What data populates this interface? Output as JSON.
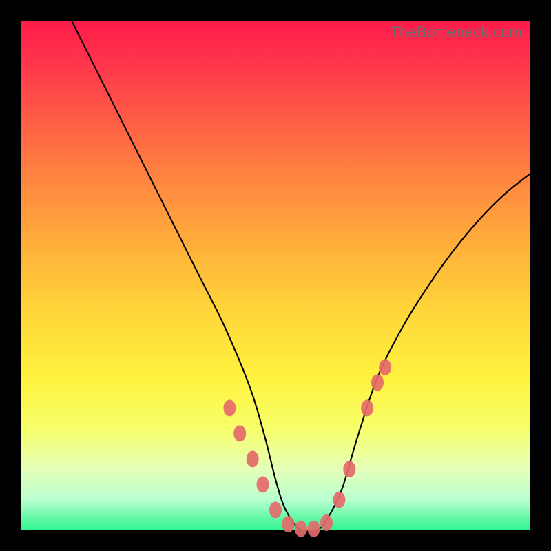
{
  "watermark": "TheBottleneck.com",
  "chart_data": {
    "type": "line",
    "title": "",
    "xlabel": "",
    "ylabel": "",
    "xlim": [
      0,
      100
    ],
    "ylim": [
      0,
      100
    ],
    "series": [
      {
        "name": "curve",
        "x": [
          10,
          15,
          20,
          25,
          30,
          35,
          40,
          45,
          48,
          50,
          52,
          55,
          58,
          60,
          63,
          66,
          70,
          75,
          80,
          85,
          90,
          95,
          100
        ],
        "y": [
          100,
          90,
          80,
          70,
          60,
          50,
          40,
          28,
          18,
          10,
          4,
          0,
          0,
          2,
          8,
          18,
          30,
          40,
          48,
          55,
          61,
          66,
          70
        ]
      }
    ],
    "markers": [
      {
        "x": 41,
        "y": 24
      },
      {
        "x": 43,
        "y": 19
      },
      {
        "x": 45.5,
        "y": 14
      },
      {
        "x": 47.5,
        "y": 9
      },
      {
        "x": 50,
        "y": 4
      },
      {
        "x": 52.5,
        "y": 1.2
      },
      {
        "x": 55,
        "y": 0.3
      },
      {
        "x": 57.5,
        "y": 0.3
      },
      {
        "x": 60,
        "y": 1.5
      },
      {
        "x": 62.5,
        "y": 6
      },
      {
        "x": 64.5,
        "y": 12
      },
      {
        "x": 68,
        "y": 24
      },
      {
        "x": 70,
        "y": 29
      },
      {
        "x": 71.5,
        "y": 32
      }
    ],
    "marker_color": "#e46a6a",
    "curve_color": "#000000"
  }
}
